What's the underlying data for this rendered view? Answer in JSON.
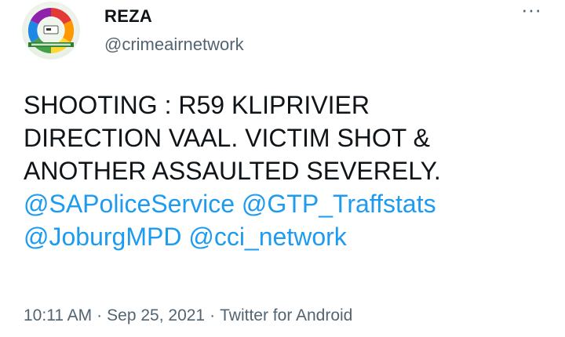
{
  "user": {
    "display_name": "REZA",
    "handle": "@crimeairnetwork",
    "avatar_icon": "crime-air-network-logo"
  },
  "more_icon": "more-options-icon",
  "more_glyph": "···",
  "tweet": {
    "lines": [
      [
        {
          "text": "SHOOTING : R59 KLIPRIVIER",
          "type": "text"
        }
      ],
      [
        {
          "text": "DIRECTION VAAL. VICTIM SHOT &",
          "type": "text"
        }
      ],
      [
        {
          "text": "ANOTHER ASSAULTED SEVERELY.",
          "type": "text"
        }
      ],
      [
        {
          "text": "@SAPoliceService",
          "type": "mention"
        },
        {
          "text": " ",
          "type": "text"
        },
        {
          "text": "@GTP_Traffstats",
          "type": "mention"
        }
      ],
      [
        {
          "text": "@JoburgMPD",
          "type": "mention"
        },
        {
          "text": " ",
          "type": "text"
        },
        {
          "text": "@cci_network",
          "type": "mention"
        }
      ]
    ]
  },
  "meta": {
    "time": "10:11 AM",
    "date": "Sep 25, 2021",
    "source": "Twitter for Android",
    "separator": "·"
  },
  "colors": {
    "link": "#1d9bf0",
    "secondary": "#536471",
    "text": "#0f1419"
  }
}
